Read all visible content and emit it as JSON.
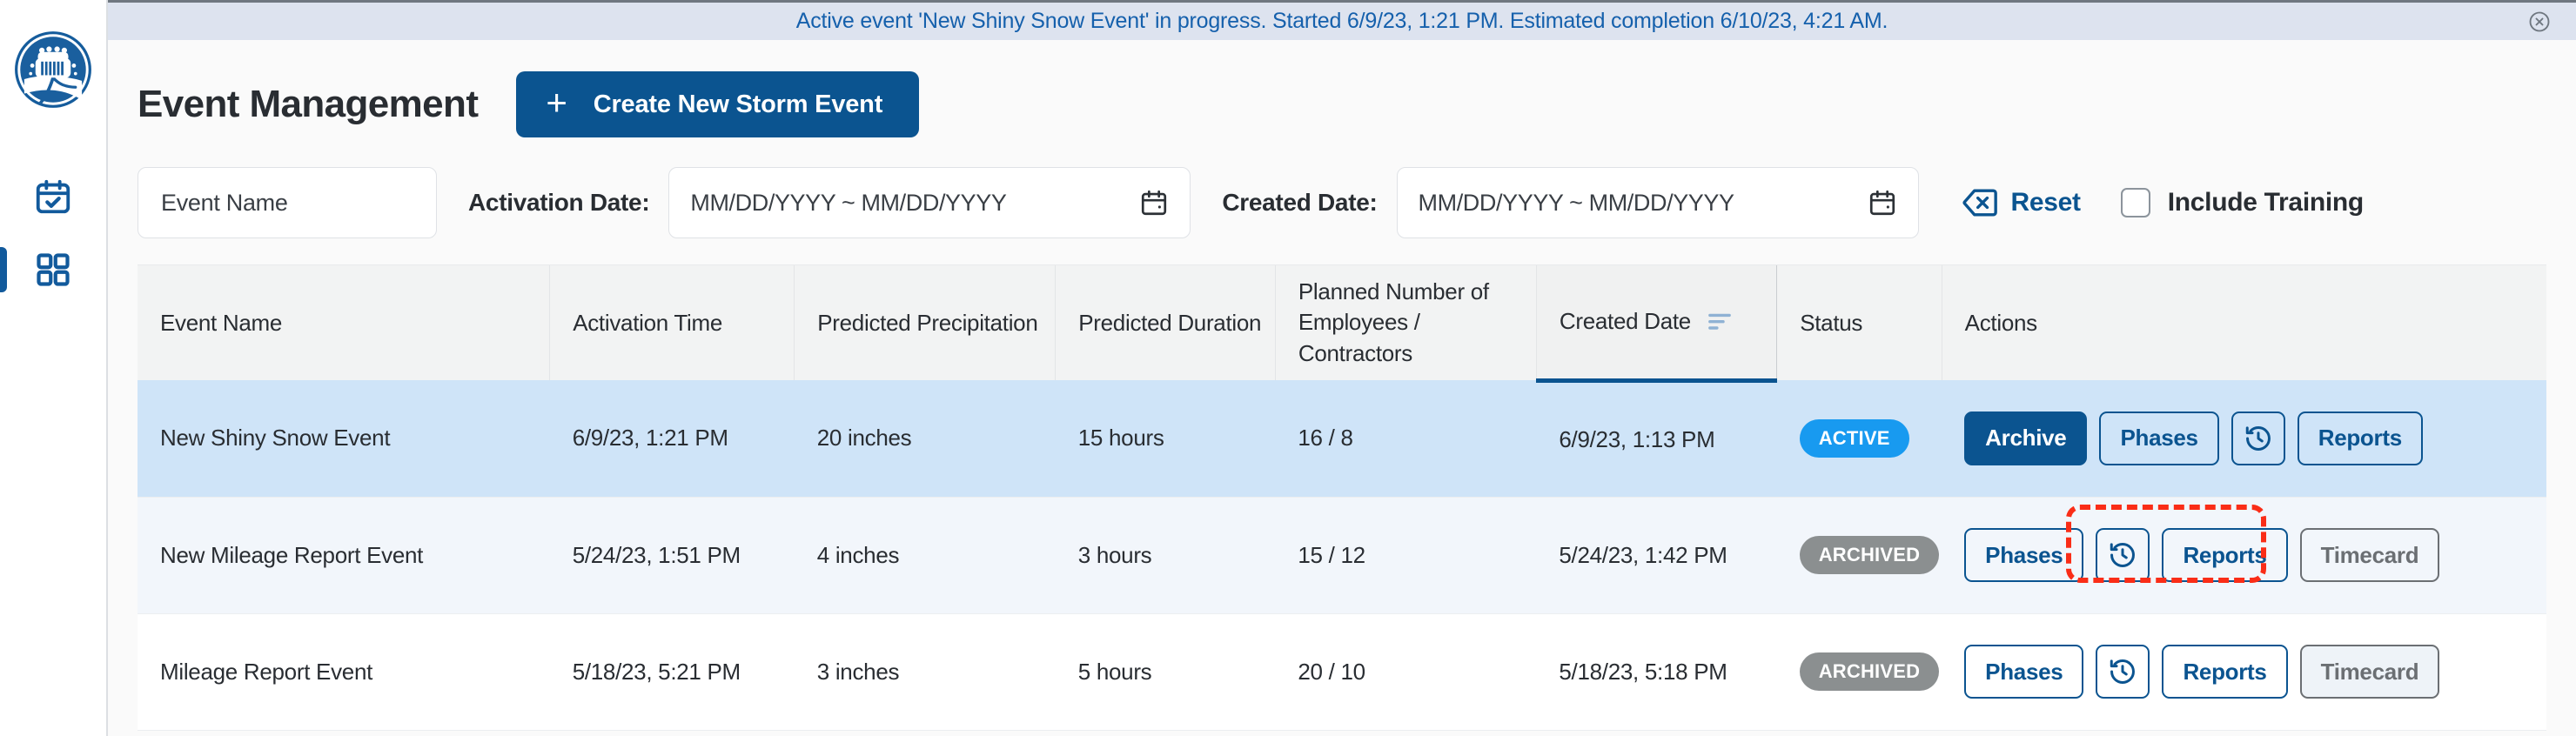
{
  "banner": {
    "message": "Active event 'New Shiny Snow Event' in progress. Started 6/9/23, 1:21 PM. Estimated completion 6/10/23, 4:21 AM.",
    "close_icon": "close-circle-icon",
    "background": "#dde3ef",
    "text_color": "#1560ac"
  },
  "sidebar": {
    "logo_icon": "snowplow-truck-logo",
    "items": [
      {
        "icon": "calendar-check-icon",
        "active": false
      },
      {
        "icon": "apps-grid-icon",
        "active": true
      }
    ],
    "accent": "#125a9c"
  },
  "header": {
    "title": "Event Management",
    "create_button": {
      "label": "Create New Storm Event",
      "icon": "plus-icon",
      "background": "#0b5490"
    }
  },
  "filters": {
    "event_name": {
      "placeholder": "Event Name",
      "value": ""
    },
    "activation_date": {
      "label": "Activation Date:",
      "placeholder": "MM/DD/YYYY ~ MM/DD/YYYY",
      "value": "",
      "icon": "calendar-icon"
    },
    "created_date": {
      "label": "Created Date:",
      "placeholder": "MM/DD/YYYY ~ MM/DD/YYYY",
      "value": "",
      "icon": "calendar-icon"
    },
    "reset": {
      "label": "Reset",
      "icon": "delete-x-icon",
      "color": "#0b5490"
    },
    "include_training": {
      "label": "Include Training",
      "checked": false
    }
  },
  "table": {
    "columns": [
      {
        "label": "Event Name",
        "sorted": false
      },
      {
        "label": "Activation Time",
        "sorted": false
      },
      {
        "label": "Predicted Precipitation",
        "sorted": false
      },
      {
        "label": "Predicted Duration",
        "sorted": false
      },
      {
        "label": "Planned Number of",
        "label2": "Employees / Contractors",
        "sorted": false
      },
      {
        "label": "Created Date",
        "sorted": true,
        "sort_icon": "sort-descending-icon"
      },
      {
        "label": "Status",
        "sorted": false
      },
      {
        "label": "Actions",
        "sorted": false
      }
    ],
    "rows": [
      {
        "event_name": "New Shiny Snow Event",
        "activation_time": "6/9/23, 1:21 PM",
        "predicted_precipitation": "20 inches",
        "predicted_duration": "15 hours",
        "planned_number": "16 / 8",
        "created_date": "6/9/23, 1:13 PM",
        "status": "ACTIVE",
        "status_style": "active",
        "highlighted": true,
        "actions": [
          {
            "label": "Archive",
            "style": "filled"
          },
          {
            "label": "Phases",
            "style": "outline"
          },
          {
            "label": "",
            "icon": "history-clock-icon",
            "style": "icon"
          },
          {
            "label": "Reports",
            "style": "outline"
          }
        ]
      },
      {
        "event_name": "New Mileage Report Event",
        "activation_time": "5/24/23, 1:51 PM",
        "predicted_precipitation": "4 inches",
        "predicted_duration": "3 hours",
        "planned_number": "15 / 12",
        "created_date": "5/24/23, 1:42 PM",
        "status": "ARCHIVED",
        "status_style": "archived",
        "highlighted": false,
        "annotated": true,
        "actions": [
          {
            "label": "Phases",
            "style": "outline"
          },
          {
            "label": "",
            "icon": "history-clock-icon",
            "style": "icon"
          },
          {
            "label": "Reports",
            "style": "outline"
          },
          {
            "label": "Timecard",
            "style": "disabled"
          }
        ]
      },
      {
        "event_name": "Mileage Report Event",
        "activation_time": "5/18/23, 5:21 PM",
        "predicted_precipitation": "3 inches",
        "predicted_duration": "5 hours",
        "planned_number": "20 / 10",
        "created_date": "5/18/23, 5:18 PM",
        "status": "ARCHIVED",
        "status_style": "archived",
        "highlighted": false,
        "actions": [
          {
            "label": "Phases",
            "style": "outline"
          },
          {
            "label": "",
            "icon": "history-clock-icon",
            "style": "icon"
          },
          {
            "label": "Reports",
            "style": "outline"
          },
          {
            "label": "Timecard",
            "style": "disabled"
          }
        ]
      }
    ]
  },
  "annotation": {
    "color": "#fa2d17",
    "style": "dashed-rectangle",
    "target": "history-and-reports-buttons-row-2"
  }
}
